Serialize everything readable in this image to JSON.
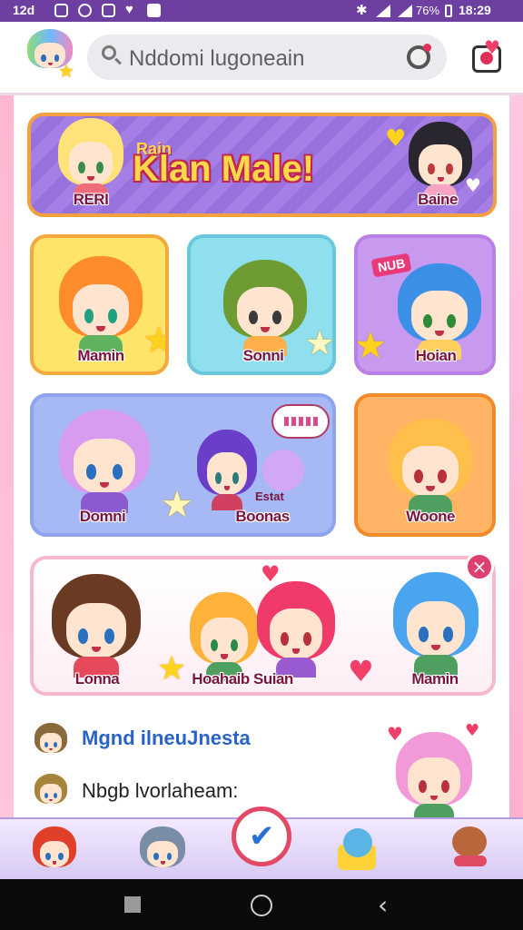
{
  "status": {
    "time": "12d",
    "battery": "76%",
    "clock": "18:29"
  },
  "header": {
    "search_placeholder": "Nddomi lugoneain"
  },
  "banner": {
    "kicker": "Rain",
    "title": "Klan Male!",
    "left_name": "RERI",
    "right_name": "Baine"
  },
  "grid": [
    {
      "name": "Mamin",
      "bg": "#ffe46a"
    },
    {
      "name": "Sonni",
      "bg": "#8fdfee"
    },
    {
      "name": "Hoian",
      "badge": "NUB",
      "bg": "#c79af0"
    },
    {
      "name": "Domni",
      "bg": "#a7b9f5"
    },
    {
      "name": "Boonas",
      "subtitle": "Estat",
      "bg": "#a7b9f5"
    },
    {
      "name": "Woone",
      "bg": "#ffb565"
    }
  ],
  "group": {
    "names": [
      "Lonna",
      "Hoahaib Suian",
      "Mamin"
    ]
  },
  "list": [
    {
      "title": "Mgnd ilneuJnesta"
    },
    {
      "title": "Nbgb lvorlaheam:"
    }
  ],
  "colors": {
    "accent": "#6c3fa0",
    "nav_active": "#e04a64"
  }
}
